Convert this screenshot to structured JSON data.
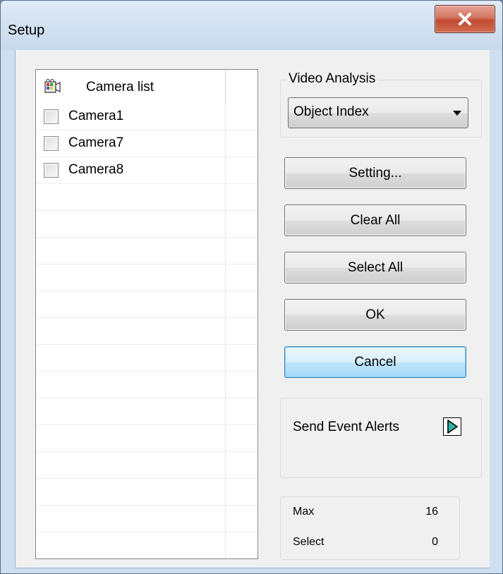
{
  "window": {
    "title": "Setup",
    "close_icon": "close-x-icon"
  },
  "camera_list": {
    "header_label": "Camera list",
    "header_icon": "camera-icon",
    "items": [
      {
        "label": "Camera1",
        "checked": false
      },
      {
        "label": "Camera7",
        "checked": false
      },
      {
        "label": "Camera8",
        "checked": false
      }
    ]
  },
  "video_analysis": {
    "group_label": "Video Analysis",
    "selected": "Object Index"
  },
  "buttons": {
    "setting": "Setting...",
    "clear_all": "Clear All",
    "select_all": "Select All",
    "ok": "OK",
    "cancel": "Cancel"
  },
  "alerts": {
    "label": "Send Event Alerts",
    "icon": "play-arrow-icon"
  },
  "stats": {
    "max_label": "Max",
    "max_value": "16",
    "select_label": "Select",
    "select_value": "0"
  },
  "colors": {
    "close_button": "#c9503a",
    "default_button": "#bee6fd",
    "play_icon_fill": "#2fb4a8"
  }
}
